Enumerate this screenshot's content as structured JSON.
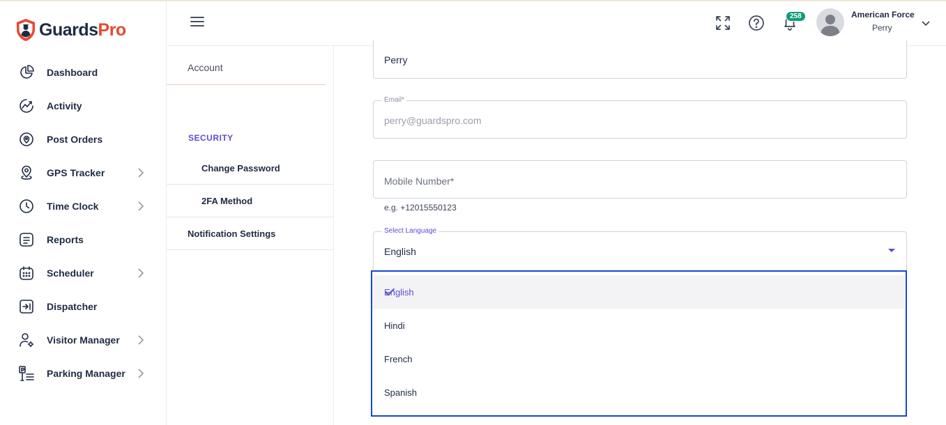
{
  "brand": {
    "part1": "Guards",
    "part2": "Pro",
    "accent": "#e8492f"
  },
  "sidebar": {
    "items": [
      {
        "label": "Dashboard",
        "icon": "pie-chart-icon",
        "has_submenu": false
      },
      {
        "label": "Activity",
        "icon": "activity-icon",
        "has_submenu": false
      },
      {
        "label": "Post Orders",
        "icon": "post-orders-icon",
        "has_submenu": false
      },
      {
        "label": "GPS Tracker",
        "icon": "location-pin-icon",
        "has_submenu": true
      },
      {
        "label": "Time Clock",
        "icon": "clock-icon",
        "has_submenu": true
      },
      {
        "label": "Reports",
        "icon": "reports-icon",
        "has_submenu": false
      },
      {
        "label": "Scheduler",
        "icon": "calendar-icon",
        "has_submenu": true
      },
      {
        "label": "Dispatcher",
        "icon": "dispatcher-icon",
        "has_submenu": false
      },
      {
        "label": "Visitor Manager",
        "icon": "visitor-icon",
        "has_submenu": true
      },
      {
        "label": "Parking Manager",
        "icon": "parking-icon",
        "has_submenu": true
      }
    ]
  },
  "header": {
    "notification_count": "258",
    "user": {
      "company": "American Force",
      "name": "Perry"
    }
  },
  "settings_menu": {
    "account_tab": "Account",
    "security_header": "SECURITY",
    "change_password": "Change Password",
    "two_fa": "2FA Method",
    "notification_settings": "Notification Settings"
  },
  "form": {
    "name_value": "Perry",
    "email_label": "Email*",
    "email_value": "perry@guardspro.com",
    "mobile_placeholder": "Mobile Number*",
    "mobile_hint": "e.g. +12015550123",
    "language_label": "Select Language",
    "language_value": "English"
  },
  "language_dropdown": {
    "options": [
      "English",
      "Hindi",
      "French",
      "Spanish"
    ],
    "selected": "English"
  },
  "colors": {
    "primary": "#5b4dd6",
    "focus_border": "#1747d4",
    "badge": "#0f9d7a"
  }
}
